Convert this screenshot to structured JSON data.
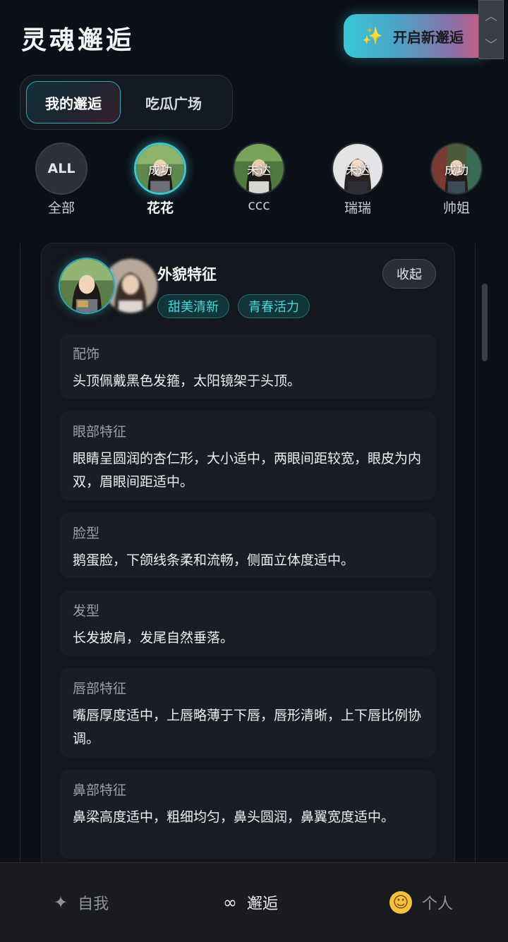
{
  "header": {
    "title": "灵魂邂逅",
    "start_button": {
      "icon": "sparkles-icon",
      "label": "开启新邂逅"
    }
  },
  "tabs": [
    {
      "label": "我的邂逅",
      "active": true
    },
    {
      "label": "吃瓜广场",
      "active": false
    }
  ],
  "people": [
    {
      "name": "全部",
      "avatar_text": "ALL",
      "status": "",
      "selected": false
    },
    {
      "name": "花花",
      "status": "成功",
      "selected": true
    },
    {
      "name": "ccc",
      "status": "未达",
      "selected": false
    },
    {
      "name": "瑞瑞",
      "status": "未达",
      "selected": false
    },
    {
      "name": "帅姐",
      "status": "成功",
      "selected": false
    }
  ],
  "card": {
    "title": "外貌特征",
    "collapse_label": "收起",
    "tags": [
      "甜美清新",
      "青春活力"
    ],
    "features": [
      {
        "label": "配饰",
        "text": "头顶佩戴黑色发箍，太阳镜架于头顶。"
      },
      {
        "label": "眼部特征",
        "text": "眼睛呈圆润的杏仁形，大小适中，两眼间距较宽，眼皮为内双，眉眼间距适中。"
      },
      {
        "label": "脸型",
        "text": "鹅蛋脸，下颌线条柔和流畅，侧面立体度适中。"
      },
      {
        "label": "发型",
        "text": "长发披肩，发尾自然垂落。"
      },
      {
        "label": "唇部特征",
        "text": "嘴唇厚度适中，上唇略薄于下唇，唇形清晰，上下唇比例协调。"
      },
      {
        "label": "鼻部特征",
        "text": "鼻梁高度适中，粗细均匀，鼻头圆润，鼻翼宽度适中。"
      }
    ]
  },
  "bottom_nav": [
    {
      "label": "自我",
      "icon": "sparkle-star-icon",
      "active": false
    },
    {
      "label": "邂逅",
      "icon": "infinity-icon",
      "active": true
    },
    {
      "label": "个人",
      "icon": "smiley-icon",
      "active": false
    }
  ],
  "colors": {
    "background": "#0c1018",
    "accent_teal": "#3fc6cf",
    "accent_pink": "#d8577c",
    "tag_text": "#48d6dd"
  }
}
